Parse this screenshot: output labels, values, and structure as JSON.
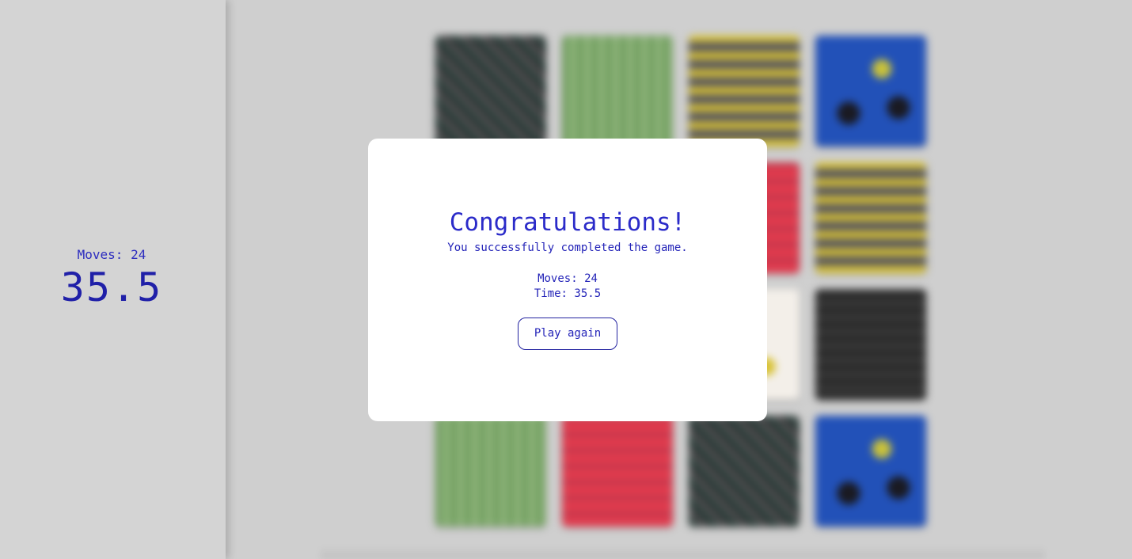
{
  "sidebar": {
    "moves_text": "Moves: 24",
    "timer_text": "35.5"
  },
  "board": {
    "tiles": [
      {
        "pattern": "dark-floral"
      },
      {
        "pattern": "green-stripes"
      },
      {
        "pattern": "yellow-grey-blocks"
      },
      {
        "pattern": "blue-birds"
      },
      {
        "pattern": "hidden"
      },
      {
        "pattern": "hidden"
      },
      {
        "pattern": "red-blocks"
      },
      {
        "pattern": "yellow-grey-blocks"
      },
      {
        "pattern": "hidden"
      },
      {
        "pattern": "hidden"
      },
      {
        "pattern": "white-floral"
      },
      {
        "pattern": "black-grid"
      },
      {
        "pattern": "green-stripes"
      },
      {
        "pattern": "red-blocks"
      },
      {
        "pattern": "dark-floral"
      },
      {
        "pattern": "blue-birds"
      }
    ]
  },
  "modal": {
    "title": "Congratulations!",
    "subtitle": "You successfully completed the game.",
    "moves_text": "Moves: 24",
    "time_text": "Time: 35.5",
    "play_again_label": "Play again"
  },
  "colors": {
    "accent": "#2323b8",
    "background": "#cfcfcf",
    "modal_background": "#ffffff"
  }
}
